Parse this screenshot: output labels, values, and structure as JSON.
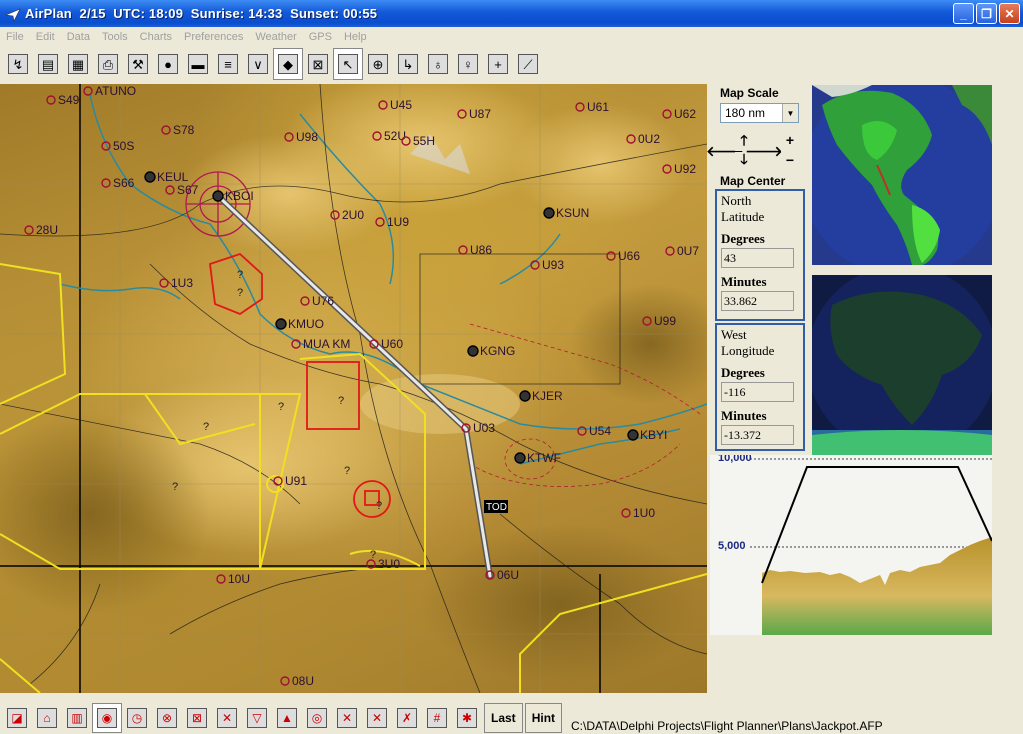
{
  "window": {
    "title": "AirPlan  2/15  UTC: 18:09  Sunrise: 14:33  Sunset: 00:55"
  },
  "menu": [
    "File",
    "Edit",
    "Data",
    "Tools",
    "Charts",
    "Preferences",
    "Weather",
    "GPS",
    "Help"
  ],
  "toolbar_top": [
    {
      "name": "route-icon",
      "glyph": "↯"
    },
    {
      "name": "new-document-icon",
      "glyph": "▤"
    },
    {
      "name": "edit-document-icon",
      "glyph": "▦"
    },
    {
      "name": "print-icon",
      "glyph": "⎙"
    },
    {
      "name": "tools-icon",
      "glyph": "⚒"
    },
    {
      "name": "globe-icon",
      "glyph": "●"
    },
    {
      "name": "terrain-icon",
      "glyph": "▬"
    },
    {
      "name": "layers-icon",
      "glyph": "≡"
    },
    {
      "name": "chevron-down-icon",
      "glyph": "∨"
    },
    {
      "name": "world-map-icon",
      "glyph": "◆",
      "pressed": true
    },
    {
      "name": "grid-icon",
      "glyph": "⊠"
    },
    {
      "name": "pointer-icon",
      "glyph": "↖",
      "pressed": true
    },
    {
      "name": "crosshair-icon",
      "glyph": "⊕"
    },
    {
      "name": "waypoint-icon",
      "glyph": "↳"
    },
    {
      "name": "pin-icon",
      "glyph": "♁"
    },
    {
      "name": "pin-outline-icon",
      "glyph": "♀"
    },
    {
      "name": "plus-icon",
      "glyph": "+"
    },
    {
      "name": "diagonal-icon",
      "glyph": "⟋"
    }
  ],
  "map": {
    "airports": [
      {
        "id": "S49"
      },
      {
        "id": "U45"
      },
      {
        "id": "U87"
      },
      {
        "id": "U61"
      },
      {
        "id": "U62"
      },
      {
        "id": "S78"
      },
      {
        "id": "U98"
      },
      {
        "id": "52U"
      },
      {
        "id": "55H"
      },
      {
        "id": "0U2"
      },
      {
        "id": "50S"
      },
      {
        "id": "U92"
      },
      {
        "id": "S66"
      },
      {
        "id": "KEUL"
      },
      {
        "id": "S67"
      },
      {
        "id": "KBOI"
      },
      {
        "id": "KSUN"
      },
      {
        "id": "28U"
      },
      {
        "id": "2U0"
      },
      {
        "id": "1U9"
      },
      {
        "id": "U86"
      },
      {
        "id": "0U7"
      },
      {
        "id": "U93"
      },
      {
        "id": "U66"
      },
      {
        "id": "1U3"
      },
      {
        "id": "U99"
      },
      {
        "id": "KMUO"
      },
      {
        "id": "U76"
      },
      {
        "id": "KGNG"
      },
      {
        "id": "U60"
      },
      {
        "id": "KJER"
      },
      {
        "id": "U03"
      },
      {
        "id": "U54"
      },
      {
        "id": "KBYI"
      },
      {
        "id": "KTWF"
      },
      {
        "id": "U91"
      },
      {
        "id": "1U0"
      },
      {
        "id": "3U0"
      },
      {
        "id": "10U"
      },
      {
        "id": "08U"
      },
      {
        "id": "06U"
      },
      {
        "id": "ATUNO"
      },
      {
        "id": "MUA KM"
      },
      {
        "id": "TOD"
      }
    ],
    "unknown_markers": [
      "?",
      "?",
      "?",
      "?",
      "?",
      "?",
      "?",
      "?",
      "?"
    ]
  },
  "panel": {
    "map_scale_label": "Map Scale",
    "map_scale_value": "180 nm",
    "map_center_label": "Map Center",
    "north": {
      "header_line1": "North",
      "header_line2": "Latitude",
      "degrees_label": "Degrees",
      "degrees": "43",
      "minutes_label": "Minutes",
      "minutes": "33.862"
    },
    "west": {
      "header_line1": "West",
      "header_line2": "Longitude",
      "degrees_label": "Degrees",
      "degrees": "-116",
      "minutes_label": "Minutes",
      "minutes": "-13.372"
    },
    "profile": {
      "top_label": "10,000",
      "mid_label": "5,000"
    }
  },
  "toolbar_bottom": [
    {
      "name": "terrain-view-icon",
      "glyph": "◪"
    },
    {
      "name": "home-icon",
      "glyph": "⌂"
    },
    {
      "name": "database-icon",
      "glyph": "▥"
    },
    {
      "name": "compass-icon",
      "glyph": "◉",
      "pressed": true
    },
    {
      "name": "clock-icon",
      "glyph": "◷"
    },
    {
      "name": "airspace-icon",
      "glyph": "⊗"
    },
    {
      "name": "restricted-icon",
      "glyph": "⊠"
    },
    {
      "name": "route-cross-icon",
      "glyph": "✕"
    },
    {
      "name": "triangle-icon",
      "glyph": "▽"
    },
    {
      "name": "mountain-icon",
      "glyph": "▲"
    },
    {
      "name": "vor-icon",
      "glyph": "◎"
    },
    {
      "name": "close-x-icon",
      "glyph": "✕"
    },
    {
      "name": "close-x-2-icon",
      "glyph": "✕"
    },
    {
      "name": "intersection-icon",
      "glyph": "✗"
    },
    {
      "name": "hash-icon",
      "glyph": "#"
    },
    {
      "name": "target-icon",
      "glyph": "✱"
    }
  ],
  "buttons": {
    "last": "Last",
    "hint": "Hint"
  },
  "status": {
    "file_path": "C:\\DATA\\Delphi Projects\\Flight Planner\\Plans\\Jackpot.AFP"
  }
}
